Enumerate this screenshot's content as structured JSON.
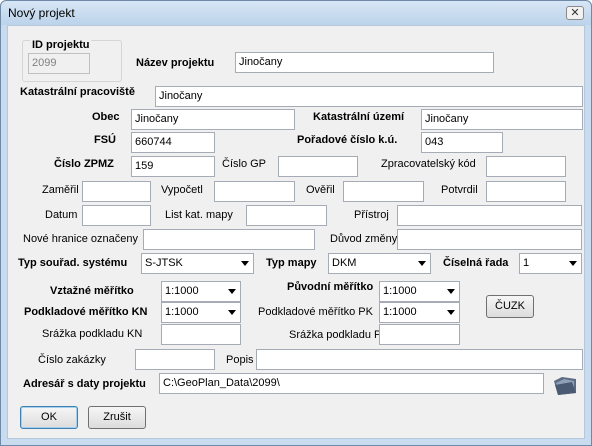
{
  "window": {
    "title": "Nový projekt",
    "close_glyph": "✕"
  },
  "id_group": {
    "label": "ID projektu",
    "value": "2099"
  },
  "labels": {
    "nazev": "Název projektu",
    "prac": "Katastrální pracoviště",
    "obec": "Obec",
    "ku": "Katastrální území",
    "fsu": "FSÚ",
    "poradove": "Pořadové číslo k.ú.",
    "zpmz": "Číslo ZPMZ",
    "gp": "Číslo GP",
    "zprac": "Zpracovatelský kód",
    "zameril": "Zaměřil",
    "vypocetl": "Vypočetl",
    "overil": "Ověřil",
    "potvrdil": "Potvrdil",
    "datum": "Datum",
    "list": "List kat. mapy",
    "pristroj": "Přístroj",
    "hranice": "Nové hranice označeny",
    "duvod": "Důvod změny",
    "typ_sour": "Typ souřad. systému",
    "typ_mapy": "Typ mapy",
    "ciselna": "Číselná řada",
    "vztazne": "Vztažné měřítko",
    "puvodni": "Původní měřítko",
    "podk_kn": "Podkladové měřítko KN",
    "podk_pk": "Podkladové měřítko PK",
    "sraz_kn": "Srážka podkladu KN",
    "sraz_pk": "Srážka podkladu PK",
    "zakazka": "Číslo zakázky",
    "popis": "Popis",
    "adresar": "Adresář s daty projektu"
  },
  "values": {
    "nazev": "Jinočany",
    "prac": "Jinočany",
    "obec": "Jinočany",
    "ku": "Jinočany",
    "fsu": "660744",
    "poradove": "043",
    "zpmz": "159",
    "gp": "",
    "zprac": "",
    "zameril": "",
    "vypocetl": "",
    "overil": "",
    "potvrdil": "",
    "datum": "",
    "list": "",
    "pristroj": "",
    "hranice": "",
    "duvod": "",
    "sraz_kn": "",
    "sraz_pk": "",
    "zakazka": "",
    "popis": "",
    "adresar": "C:\\GeoPlan_Data\\2099\\"
  },
  "selects": {
    "typ_sour": "S-JTSK",
    "typ_mapy": "DKM",
    "ciselna": "1",
    "vztazne": "1:1000",
    "puvodni": "1:1000",
    "podk_kn": "1:1000",
    "podk_pk": "1:1000"
  },
  "buttons": {
    "cuzk": "ČUZK",
    "ok": "OK",
    "cancel": "Zrušit"
  },
  "icons": {
    "close": "close-icon",
    "folder": "folder-icon"
  }
}
